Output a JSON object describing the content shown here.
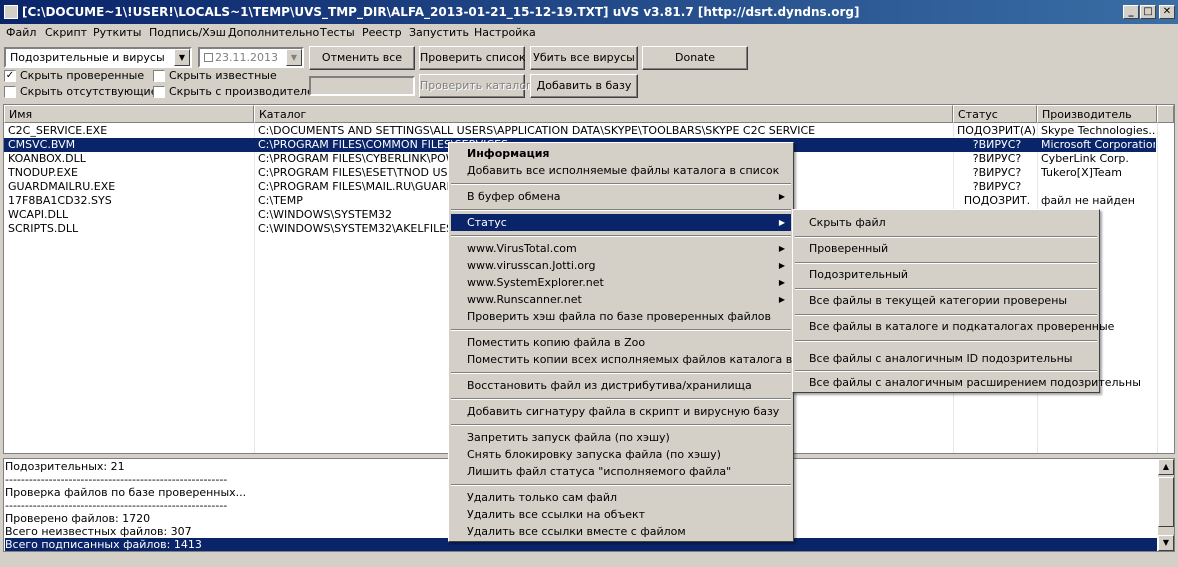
{
  "window": {
    "title": "[C:\\DOCUME~1\\!USER!\\LOCALS~1\\TEMP\\UVS_TMP_DIR\\ALFA_2013-01-21_15-12-19.TXT] uVS v3.81.7 [http://dsrt.dyndns.org]",
    "minimize": "_",
    "maximize": "□",
    "close": "✕"
  },
  "menu": [
    "Файл",
    "Скрипт",
    "Руткиты",
    "Подпись/Хэш",
    "Дополнительно",
    "Тесты",
    "Реестр",
    "Запустить",
    "Настройка"
  ],
  "toolbar": {
    "filter_value": "Подозрительные и вирусы",
    "date_value": "23.11.2013",
    "cancel_all": "Отменить все",
    "check_list": "Проверить список",
    "kill_viruses": "Убить все вирусы",
    "donate": "Donate",
    "check_folder": "Проверить каталог",
    "add_to_db": "Добавить в базу",
    "hide_checked": "Скрыть проверенные",
    "hide_known": "Скрыть известные",
    "hide_missing": "Скрыть отсутствующие",
    "hide_by_vendor": "Скрыть с производителем"
  },
  "table": {
    "columns": [
      "Имя",
      "Каталог",
      "Статус",
      "Производитель"
    ],
    "rows": [
      {
        "name": "C2C_SERVICE.EXE",
        "path": "C:\\DOCUMENTS AND SETTINGS\\ALL USERS\\APPLICATION DATA\\SKYPE\\TOOLBARS\\SKYPE C2C SERVICE",
        "status": "ПОДОЗРИТ(А)",
        "vendor": "Skype Technologies..."
      },
      {
        "name": "CMSVC.BVM",
        "path": "C:\\PROGRAM FILES\\COMMON FILES\\SERVICES",
        "status": "?ВИРУС?",
        "vendor": "Microsoft Corporation"
      },
      {
        "name": "KOANBOX.DLL",
        "path": "C:\\PROGRAM FILES\\CYBERLINK\\POWER",
        "status": "?ВИРУС?",
        "vendor": "CyberLink Corp."
      },
      {
        "name": "TNODUP.EXE",
        "path": "C:\\PROGRAM FILES\\ESET\\TNOD USER",
        "status": "?ВИРУС?",
        "vendor": "Tukero[X]Team"
      },
      {
        "name": "GUARDMAILRU.EXE",
        "path": "C:\\PROGRAM FILES\\MAIL.RU\\GUARD",
        "status": "?ВИРУС?",
        "vendor": ""
      },
      {
        "name": "17F8BA1CD32.SYS",
        "path": "C:\\TEMP",
        "status": "ПОДОЗРИТ.",
        "vendor": "файл не найден"
      },
      {
        "name": "WCAPI.DLL",
        "path": "C:\\WINDOWS\\SYSTEM32",
        "status": "",
        "vendor": ""
      },
      {
        "name": "SCRIPTS.DLL",
        "path": "C:\\WINDOWS\\SYSTEM32\\AKELFILES\\PL",
        "status": "",
        "vendor": ""
      }
    ]
  },
  "log": [
    "Подозрительных: 21",
    "--------------------------------------------------------",
    "Проверка файлов по базе проверенных...",
    "--------------------------------------------------------",
    "Проверено файлов: 1720",
    "Всего неизвестных файлов: 307",
    "Всего подписанных файлов: 1413"
  ],
  "context_menu": {
    "info": "Информация",
    "add_exec_files": "Добавить все исполняемые файлы каталога в список",
    "clipboard": "В буфер обмена",
    "status": "Статус",
    "virustotal": "www.VirusTotal.com",
    "jotti": "www.virusscan.Jotti.org",
    "sysexplorer": "www.SystemExplorer.net",
    "runscanner": "www.Runscanner.net",
    "check_hash": "Проверить хэш файла по базе проверенных файлов",
    "copy_zoo": "Поместить копию файла в Zoo",
    "copy_all_zoo": "Поместить копии всех исполняемых файлов каталога в Zoo",
    "restore": "Восстановить файл из дистрибутива/хранилища",
    "add_signature": "Добавить сигнатуру файла в скрипт и вирусную базу",
    "block_run": "Запретить запуск файла (по хэшу)",
    "unblock_run": "Снять блокировку запуска файла (по хэшу)",
    "remove_exec_status": "Лишить файл статуса \"исполняемого файла\"",
    "delete_file": "Удалить только сам файл",
    "delete_refs": "Удалить все ссылки на объект",
    "delete_refs_file": "Удалить все ссылки вместе с файлом"
  },
  "status_submenu": {
    "hide_file": "Скрыть файл",
    "checked": "Проверенный",
    "suspicious": "Подозрительный",
    "all_category_checked": "Все файлы в текущей категории проверены",
    "all_folder_checked": "Все файлы в каталоге и подкаталогах проверенные",
    "same_id_suspicious": "Все файлы с аналогичным ID  подозрительны",
    "same_ext_suspicious": "Все файлы с аналогичным расширением подозрительны"
  }
}
